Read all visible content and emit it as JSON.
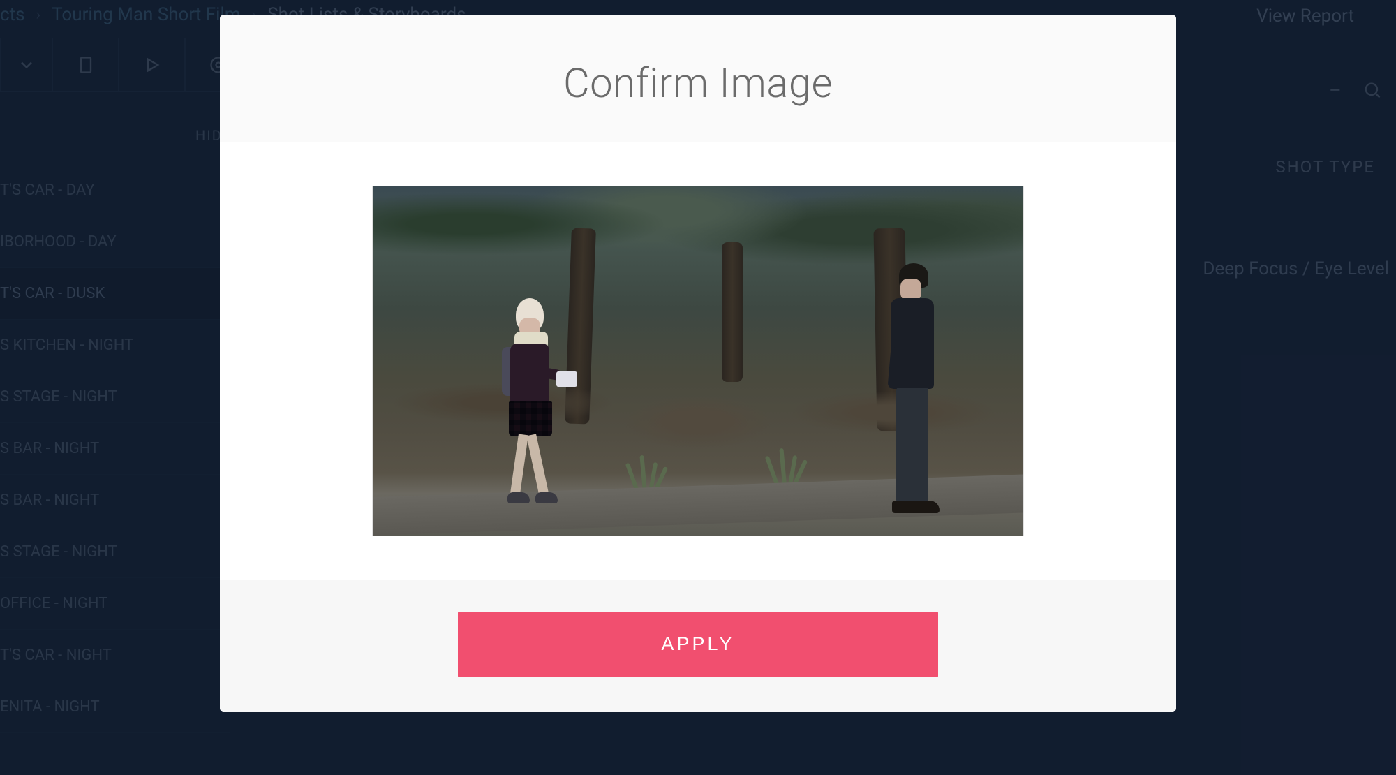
{
  "breadcrumb": {
    "root": "cts",
    "project": "Touring Man Short Film",
    "section": "Shot Lists & Storyboards"
  },
  "header": {
    "view_report": "View Report",
    "hide": "HIDE",
    "shot_type": "SHOT TYPE"
  },
  "sidebar": {
    "items": [
      "T'S CAR - DAY",
      "IBORHOOD - DAY",
      "T'S CAR - DUSK",
      "S KITCHEN - NIGHT",
      "S STAGE - NIGHT",
      "S BAR - NIGHT",
      "S BAR - NIGHT",
      "S STAGE - NIGHT",
      "OFFICE - NIGHT",
      "T'S CAR - NIGHT",
      "ENITA - NIGHT"
    ],
    "active_index": 2
  },
  "shot_detail": {
    "description": "Deep Focus / Eye Level"
  },
  "modal": {
    "title": "Confirm Image",
    "apply_label": "APPLY"
  }
}
